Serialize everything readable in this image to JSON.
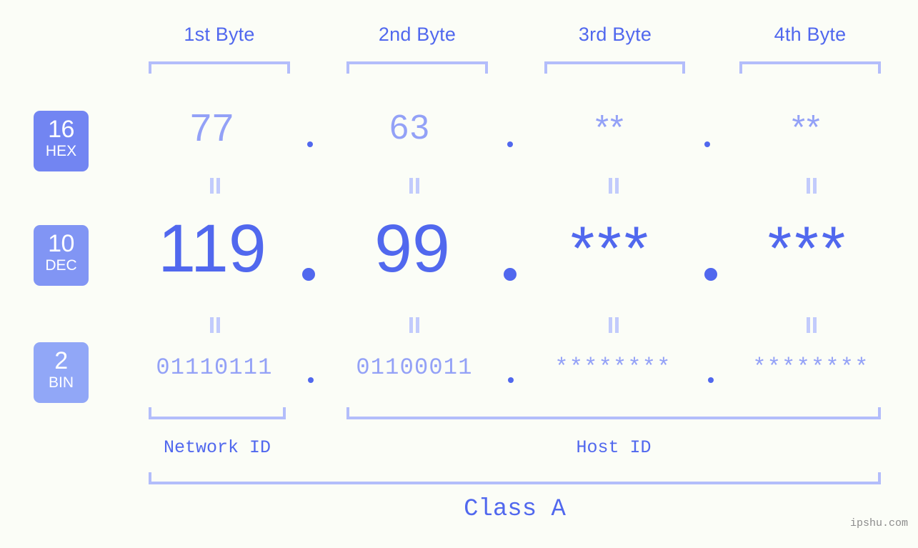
{
  "canvas": {
    "background": "#fbfdf7",
    "accent_strong": "#5168ee",
    "accent_light": "#93a1f7",
    "accent_bracket": "#b3bdfb"
  },
  "byte_headers": [
    {
      "label": "1st Byte"
    },
    {
      "label": "2nd Byte"
    },
    {
      "label": "3rd Byte"
    },
    {
      "label": "4th Byte"
    }
  ],
  "radix_badges": [
    {
      "radix": "16",
      "name": "HEX",
      "color": "#7285f2"
    },
    {
      "radix": "10",
      "name": "DEC",
      "color": "#8195f4"
    },
    {
      "radix": "2",
      "name": "BIN",
      "color": "#91a7f7"
    }
  ],
  "rows": {
    "hex": {
      "values": [
        "77",
        "63",
        "**",
        "**"
      ],
      "separator": "."
    },
    "dec": {
      "values": [
        "119",
        "99",
        "***",
        "***"
      ],
      "separator": "."
    },
    "bin": {
      "values": [
        "01110111",
        "01100011",
        "********",
        "********"
      ],
      "separator": "."
    }
  },
  "equals_symbol": "=",
  "id_sections": [
    {
      "label": "Network ID"
    },
    {
      "label": "Host ID"
    }
  ],
  "class_section": {
    "label": "Class A"
  },
  "watermark": {
    "text": "ipshu.com"
  }
}
